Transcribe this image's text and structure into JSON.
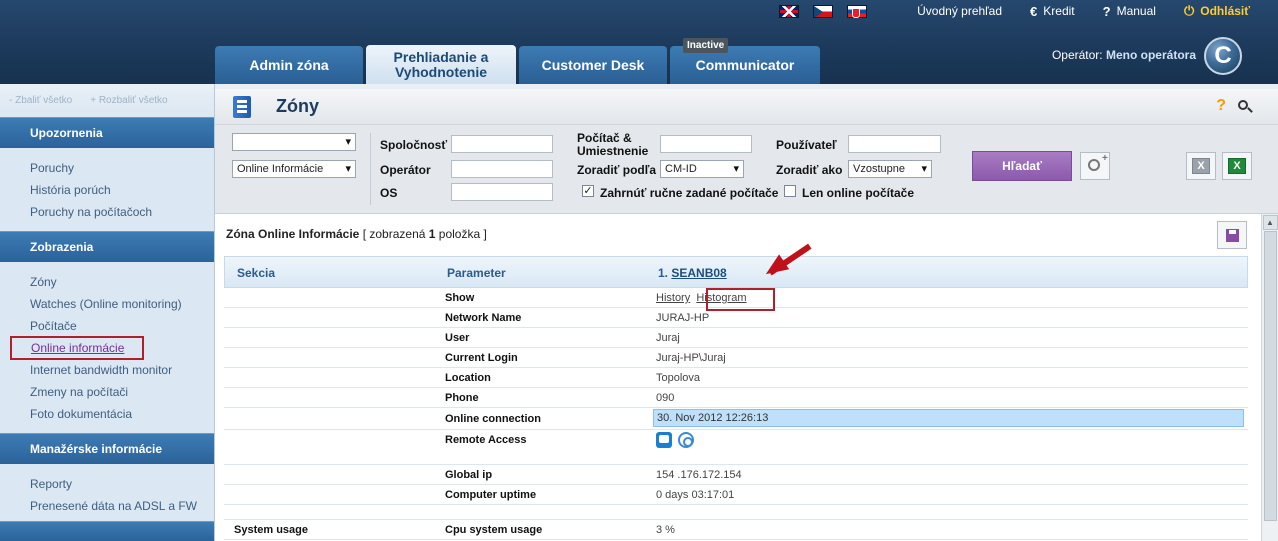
{
  "topbar": {
    "flags": [
      "flag-en",
      "flag-cz",
      "flag-sk"
    ],
    "links": [
      {
        "icon": "",
        "label": "Úvodný prehľad"
      },
      {
        "icon": "€",
        "label": "Kredit"
      },
      {
        "icon": "?",
        "label": "Manual"
      },
      {
        "icon": "⏻",
        "label": "Odhlásiť"
      }
    ]
  },
  "tabs": [
    {
      "label": "Admin zóna"
    },
    {
      "label": "Prehliadanie a Vyhodnotenie"
    },
    {
      "label": "Customer Desk"
    },
    {
      "label": "Communicator",
      "badge": "Inactive"
    }
  ],
  "operator": {
    "label": "Operátor:",
    "name": "Meno operátora"
  },
  "logo_letter": "C",
  "sidebar": {
    "toggles": [
      "- Zbaliť všetko",
      "+ Rozbaliť všetko"
    ],
    "sections": [
      {
        "title": "Upozornenia",
        "items": [
          "Poruchy",
          "História porúch",
          "Poruchy na počítačoch"
        ]
      },
      {
        "title": "Zobrazenia",
        "items": [
          "Zóny",
          "Watches (Online monitoring)",
          "Počítače",
          "Online informácie",
          "Internet bandwidth monitor",
          "Zmeny na počítači",
          "Foto dokumentácia"
        ]
      },
      {
        "title": "Manažérske informácie",
        "items": [
          "Reporty",
          "Prenesené dáta na ADSL a FW"
        ]
      }
    ]
  },
  "page": {
    "title": "Zóny"
  },
  "filters": {
    "select1": "",
    "select2": "Online Informácie",
    "company_label": "Spoločnosť",
    "operator_label": "Operátor",
    "os_label": "OS",
    "computer_label_1": "Počítač &",
    "computer_label_2": "Umiestnenie",
    "sort_label": "Zoradiť podľa",
    "sort_value": "CM-ID",
    "user_label": "Používateľ",
    "sort_as_label": "Zoradiť ako",
    "sort_as_value": "Vzostupne",
    "chk_manual_label": "Zahrnúť ručne zadané počítače",
    "chk_online_label": "Len online počítače",
    "search_button": "Hľadať"
  },
  "content": {
    "title_pre": "Zóna Online Informácie",
    "title_mid": "[ zobrazená",
    "count": "1",
    "title_post": "položka ]",
    "header": {
      "section": "Sekcia",
      "parameter": "Parameter",
      "computer_index": "1.",
      "computer_name": "SEANB08"
    },
    "show_links": [
      "History",
      "Histogram"
    ],
    "rows": [
      {
        "param": "Network Name",
        "value": "JURAJ-HP"
      },
      {
        "param": "User",
        "value": "Juraj"
      },
      {
        "param": "Current Login",
        "value": "Juraj-HP\\Juraj"
      },
      {
        "param": "Location",
        "value": "Topolova"
      },
      {
        "param": "Phone",
        "value": "090"
      }
    ],
    "online": {
      "param": "Online connection",
      "value": "30. Nov 2012 12:26:13"
    },
    "remote": {
      "param": "Remote Access"
    },
    "show_param": "Show",
    "rows2": [
      {
        "param": "Global ip",
        "value": "154 .176.172.154"
      },
      {
        "param": "Computer uptime",
        "value": "0 days 03:17:01"
      }
    ],
    "system": {
      "section": "System usage",
      "param": "Cpu system usage",
      "value": "3 %"
    }
  }
}
